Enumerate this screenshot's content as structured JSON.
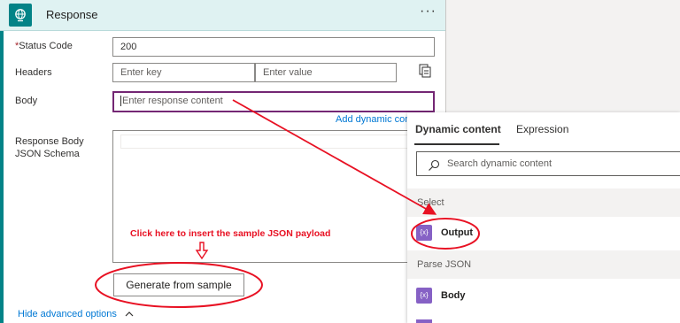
{
  "card": {
    "title": "Response",
    "more_glyph": "···",
    "status_code": {
      "required_mark": "*",
      "label": "Status Code",
      "value": "200"
    },
    "headers": {
      "label": "Headers",
      "key_placeholder": "Enter key",
      "value_placeholder": "Enter value"
    },
    "body": {
      "label": "Body",
      "placeholder": "Enter response content",
      "add_dynamic_label": "Add dynamic cont"
    },
    "schema": {
      "label": "Response Body JSON Schema"
    },
    "generate_button": "Generate from sample",
    "hide_advanced": "Hide advanced options"
  },
  "annotation": {
    "text": "Click here to insert the sample JSON payload",
    "color": "#e81123"
  },
  "dynamic_panel": {
    "tabs": [
      {
        "label": "Dynamic content",
        "active": true
      },
      {
        "label": "Expression",
        "active": false
      }
    ],
    "search_placeholder": "Search dynamic content",
    "sections": [
      {
        "title": "Select",
        "items": [
          {
            "label": "Output",
            "icon": "variable-icon",
            "icon_text": "{x}"
          }
        ]
      },
      {
        "title": "Parse JSON",
        "items": [
          {
            "label": "Body",
            "icon": "variable-icon",
            "icon_text": "{x}"
          }
        ]
      }
    ]
  },
  "colors": {
    "accent": "#038387",
    "focus": "#742774",
    "link": "#0078d4",
    "icon": "#8661c5"
  }
}
